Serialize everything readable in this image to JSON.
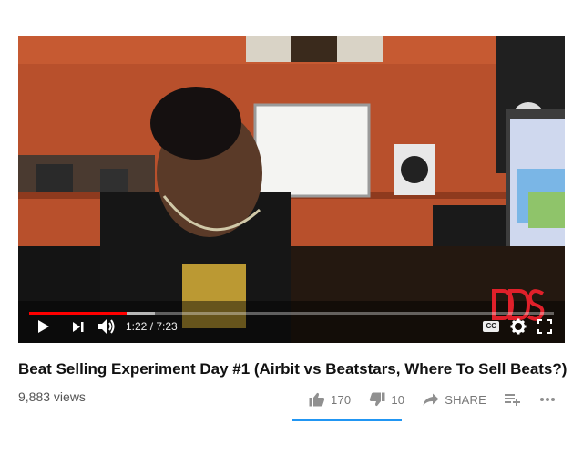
{
  "video": {
    "time_current": "1:22",
    "time_separator": " / ",
    "time_total": "7:23",
    "progress_played": 0.185,
    "progress_loaded": 0.24,
    "watermark": "DDS"
  },
  "controls": {
    "play_icon": "play-icon",
    "next_icon": "next-icon",
    "volume_icon": "volume-icon",
    "cc_label": "CC",
    "settings_icon": "gear-icon",
    "fullscreen_icon": "fullscreen-icon"
  },
  "info": {
    "title": "Beat Selling Experiment Day #1 (Airbit vs Beatstars, Where To Sell Beats?)",
    "views": "9,883 views",
    "likes": "170",
    "dislikes": "10",
    "share_label": "SHARE"
  },
  "colors": {
    "progress": "#ff0000",
    "like_bar": "#2196f3",
    "wall": "#b8502c",
    "watermark": "#e0202a"
  }
}
